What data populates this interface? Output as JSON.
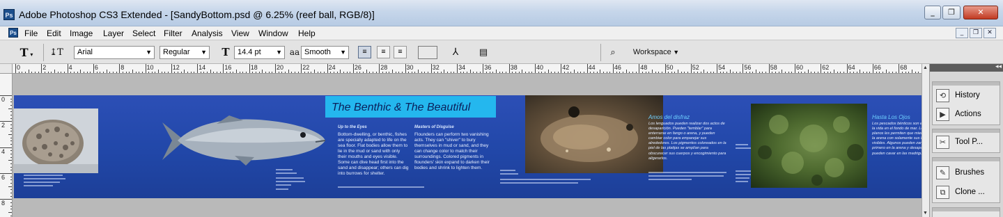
{
  "window": {
    "title": "Adobe Photoshop CS3 Extended - [SandyBottom.psd @ 6.25% (reef ball, RGB/8)]",
    "app_icon": "Ps",
    "controls": [
      "_",
      "❐",
      "✕"
    ]
  },
  "menu": [
    "File",
    "Edit",
    "Image",
    "Layer",
    "Select",
    "Filter",
    "Analysis",
    "View",
    "Window",
    "Help"
  ],
  "doc_controls": [
    "_",
    "❐",
    "✕"
  ],
  "options": {
    "tool_glyph": "T",
    "font_family": "Arial",
    "font_style": "Regular",
    "font_size": "14.4 pt",
    "antialias_prefix": "aa",
    "antialias": "Smooth",
    "workspace_label": "Workspace"
  },
  "rulers": {
    "h_labels": [
      "0",
      "2",
      "4",
      "6",
      "8",
      "10",
      "12",
      "14",
      "16",
      "18",
      "20",
      "22",
      "24",
      "26",
      "28",
      "30",
      "32",
      "34",
      "36",
      "38",
      "40",
      "42",
      "44",
      "46",
      "48",
      "50",
      "52",
      "54",
      "56",
      "58",
      "60",
      "62",
      "64",
      "66",
      "68"
    ],
    "v_labels": [
      "0",
      "2",
      "4",
      "6",
      "8"
    ]
  },
  "document": {
    "title": "The Benthic & The Beautiful",
    "col1_heading": "Up to the Eyes",
    "col1_body": "Bottom-dwelling, or benthic, fishes are specially adapted to life on the sea floor. Flat bodies allow them to lie in the mud or sand with only their mouths and eyes visible. Some can dive head first into the sand and disappear; others can dig into burrows for shelter.",
    "col2_heading": "Masters of Disguise",
    "col2_body": "Flounders can perform two vanishing acts. They can \"shiver\" to bury themselves in mud or sand, and they can change color to match their surroundings. Colored pigments in flounders' skin expand to darken their bodies and shrink to lighten them.",
    "spanish1_heading": "Amos del disfraz",
    "spanish1_body": "Los lenguados pueden realizar dos actos de desaparición. Pueden \"temblar\" para enterrarse en fango o arena, y pueden cambiar color para emparejar sus alrededores. Los pigmentos coloreados en la piel de las platijas se amplían para obscurecer sus cuerpos y encogimiento para aligerarlos.",
    "spanish2_heading": "Hasta Los Ojos",
    "spanish2_body": "Los pescados bénticos son especialmente a la vida en el fondo de mar. Los cuerpos planos les permiten que mienten en el fango o la arena con solamente sus bocas y ojos visibles. Algunos pueden zambullir la cabeza primero en la arena y desaparecer; otros pueden cavar en las madrigueras para abrigo."
  },
  "panels": {
    "group1": [
      {
        "icon": "history-icon",
        "glyph": "⟲",
        "label": "History"
      },
      {
        "icon": "actions-icon",
        "glyph": "▶",
        "label": "Actions"
      }
    ],
    "group2": [
      {
        "icon": "tool-presets-icon",
        "glyph": "✂",
        "label": "Tool P..."
      }
    ],
    "group3": [
      {
        "icon": "brushes-icon",
        "glyph": "✎",
        "label": "Brushes"
      },
      {
        "icon": "clone-source-icon",
        "glyph": "⧉",
        "label": "Clone ..."
      }
    ]
  }
}
